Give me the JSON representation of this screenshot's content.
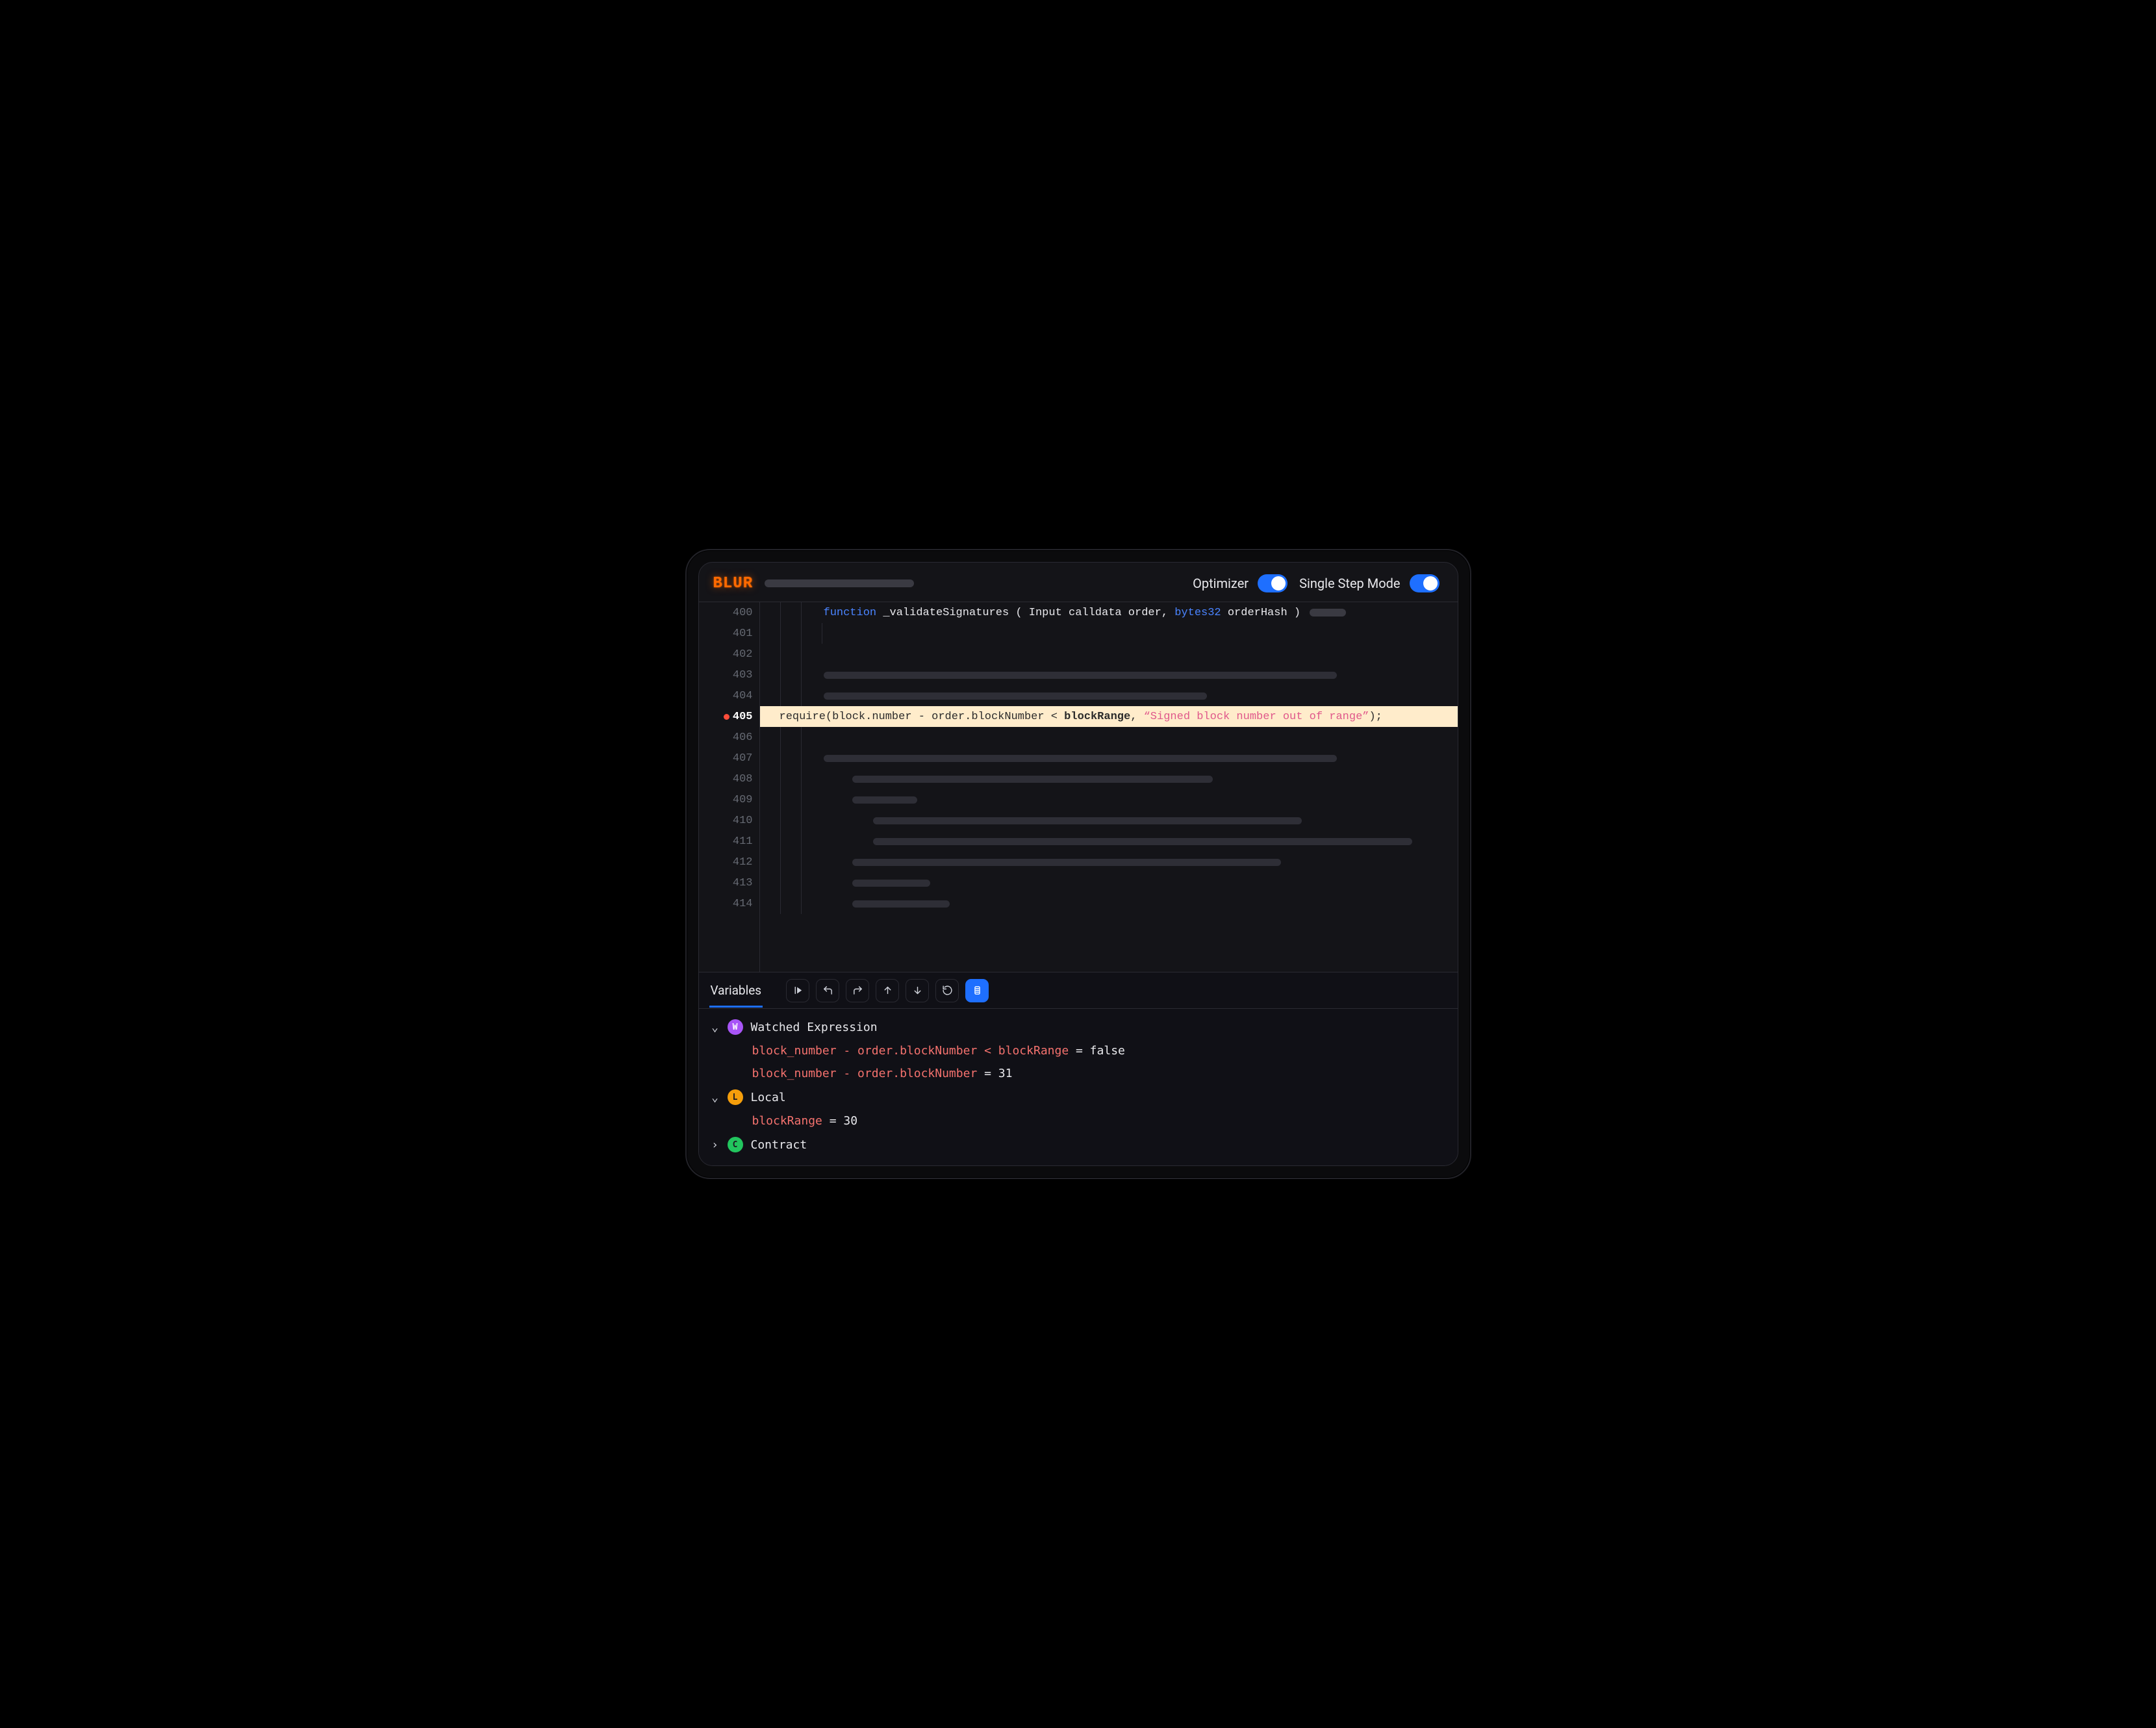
{
  "brand": "BLUR",
  "toggles": {
    "optimizer_label": "Optimizer",
    "single_step_label": "Single Step Mode",
    "optimizer_on": true,
    "single_step_on": true
  },
  "editor": {
    "line_start": 400,
    "line_end": 414,
    "active_line": 405,
    "func_signature": {
      "keyword": "function",
      "name": " _validateSignatures ",
      "open": "(",
      "param1": " Input calldata order, ",
      "type2": "bytes32",
      "param2": " orderHash ",
      "close": ")"
    },
    "highlighted_code": {
      "prefix": "require(block.number - order.blockNumber < ",
      "bold": "blockRange",
      "mid": ", ",
      "string": "“Signed block number out of range”",
      "suffix": ");"
    }
  },
  "debugger": {
    "tab_label": "Variables",
    "groups": {
      "watched": {
        "label": "Watched Expression",
        "badge": "W",
        "expanded": true,
        "items": [
          {
            "key": "block_number - order.blockNumber < blockRange",
            "value": "false"
          },
          {
            "key": "block_number - order.blockNumber",
            "value": "31"
          }
        ]
      },
      "local": {
        "label": "Local",
        "badge": "L",
        "expanded": true,
        "items": [
          {
            "key": "blockRange",
            "value": "30"
          }
        ]
      },
      "contract": {
        "label": "Contract",
        "badge": "C",
        "expanded": false
      }
    }
  }
}
